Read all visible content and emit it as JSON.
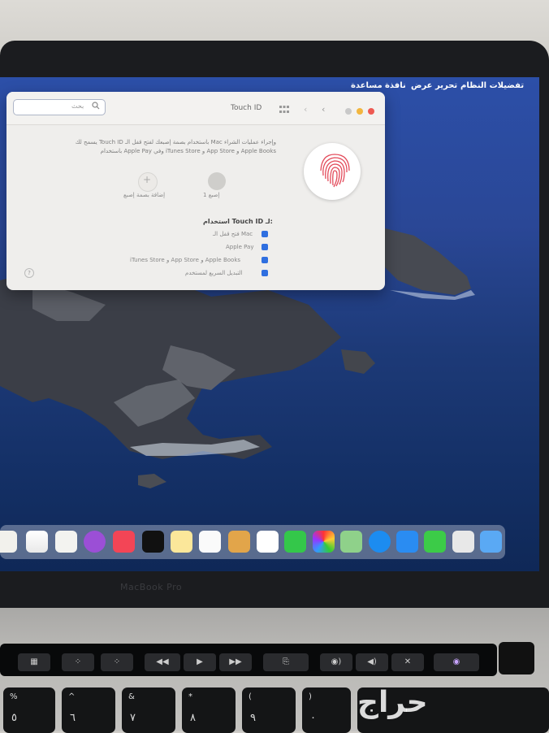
{
  "menubar": {
    "apple": "",
    "app_name": "تفضيلات النظام",
    "edit": "تحرير",
    "view": "عرض",
    "window": "نافذة",
    "help": "مساعدة"
  },
  "window": {
    "title": "Touch ID",
    "search_placeholder": "بحث",
    "description_line1": "يسمح لك Touch ID باستخدام بصمة إصبعك لفتح قفل الـ Mac وإجراء عمليات الشراء",
    "description_line2": "باستخدام Apple Pay وفي iTunes Store و App Store و Apple Books",
    "finger1_label": "إصبع 1",
    "add_fingerprint_label": "إضافة بصمة إصبع",
    "use_heading": "استخدام Touch ID لـ:",
    "options": [
      "فتح قفل الـ Mac",
      "Apple Pay",
      "iTunes Store و App Store و Apple Books",
      "التبديل السريع لمستخدم"
    ],
    "help_label": "?"
  },
  "bezel": {
    "model_label": "MacBook Pro"
  },
  "touchbar": {
    "keys": [
      "▦",
      "⁘",
      "⁘",
      "◀◀",
      "▶",
      "▶▶",
      "⎘",
      "◉)",
      "◀)",
      "✕",
      "◉"
    ]
  },
  "keyboard": {
    "keys": [
      "٥",
      "٦",
      "٧",
      "٨",
      "٩",
      "٠"
    ],
    "secondary": [
      "%",
      "^",
      "&",
      "*",
      "(",
      ")"
    ]
  },
  "watermark": {
    "text": "حراج"
  },
  "colors": {
    "accent": "#2f6fe0",
    "close": "#ee5a52",
    "minimize": "#f2b63f",
    "zoom": "#c9c9c9",
    "fingerprint": "#e34a5a"
  }
}
